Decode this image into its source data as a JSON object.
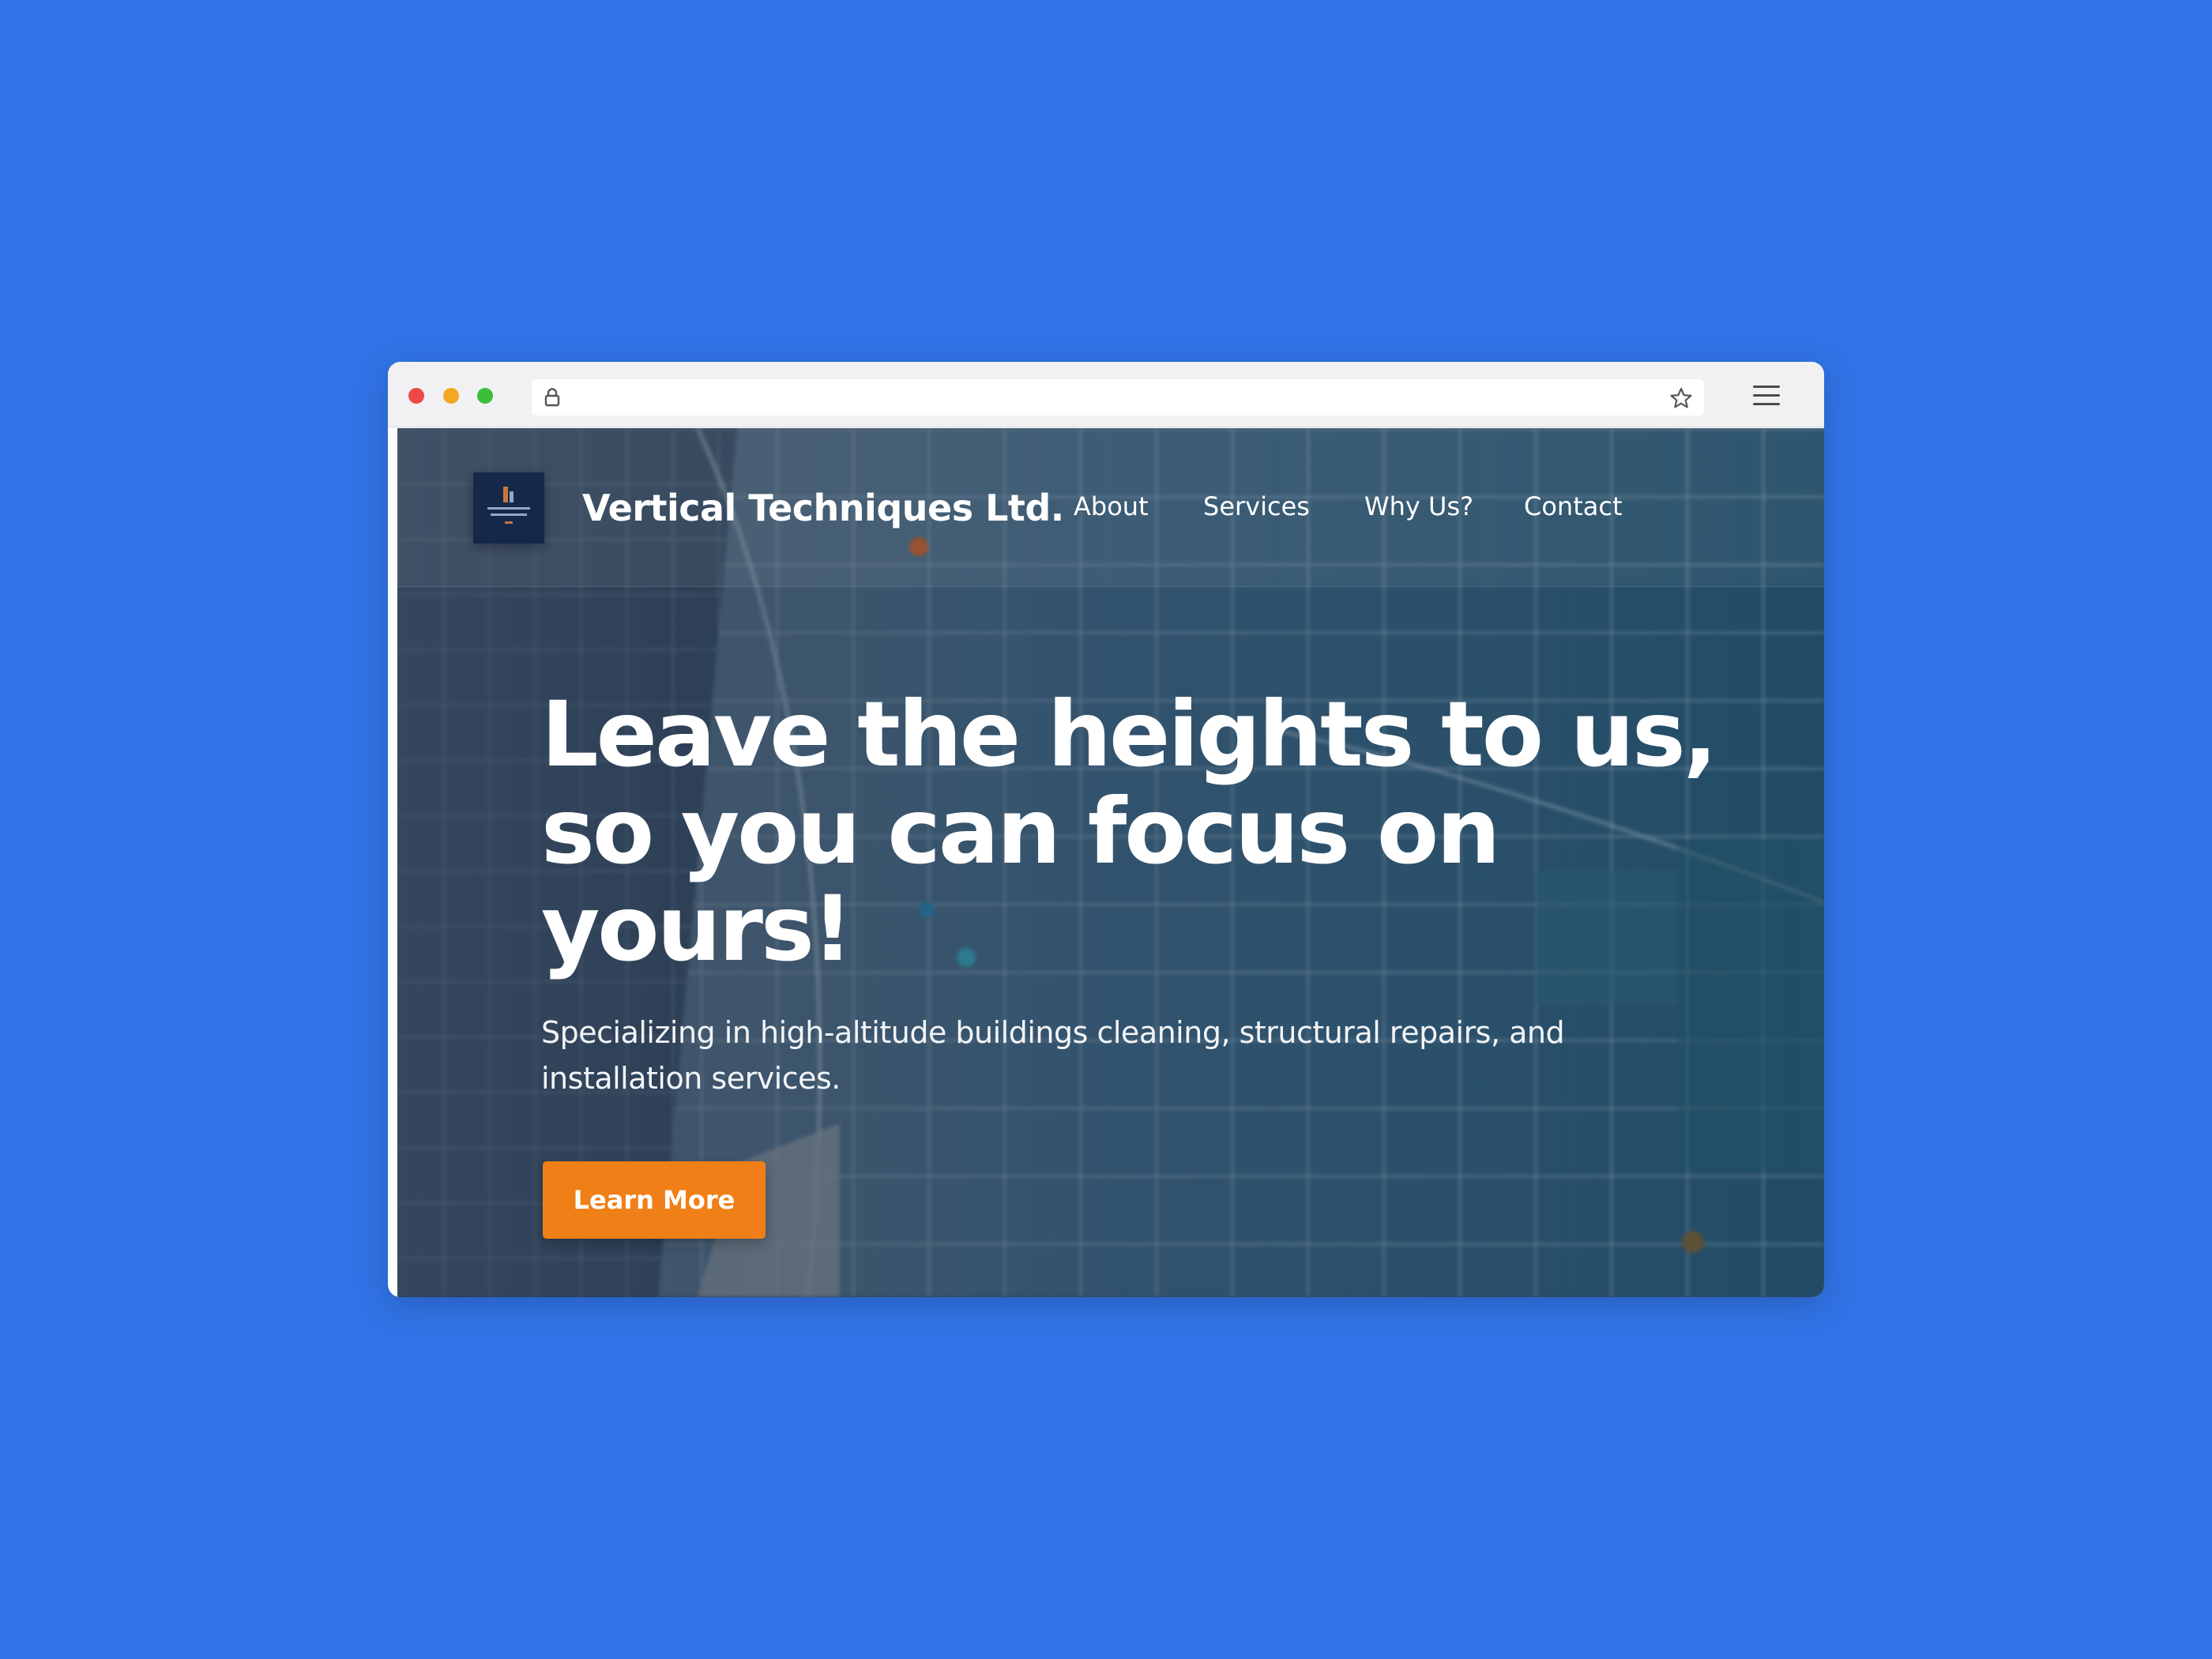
{
  "browser": {
    "url": ""
  },
  "site": {
    "brand_name": "Vertical Techniques Ltd.",
    "nav": [
      {
        "label": "About"
      },
      {
        "label": "Services"
      },
      {
        "label": "Why Us?"
      },
      {
        "label": "Contact"
      }
    ]
  },
  "hero": {
    "title": "Leave the heights to us, so you can focus on yours!",
    "subtitle": "Specializing in high-altitude buildings cleaning, structural repairs, and installation services.",
    "cta_label": "Learn More"
  },
  "colors": {
    "page_background": "#3173e6",
    "cta": "#f07f17",
    "logo_background": "#15284a",
    "traffic_red": "#ec4a4a",
    "traffic_yellow": "#f5a623",
    "traffic_green": "#3bbf3b"
  },
  "icons": {
    "lock": "lock-icon",
    "bookmark": "star-icon",
    "menu": "hamburger-menu-icon",
    "logo": "company-logo-icon"
  }
}
